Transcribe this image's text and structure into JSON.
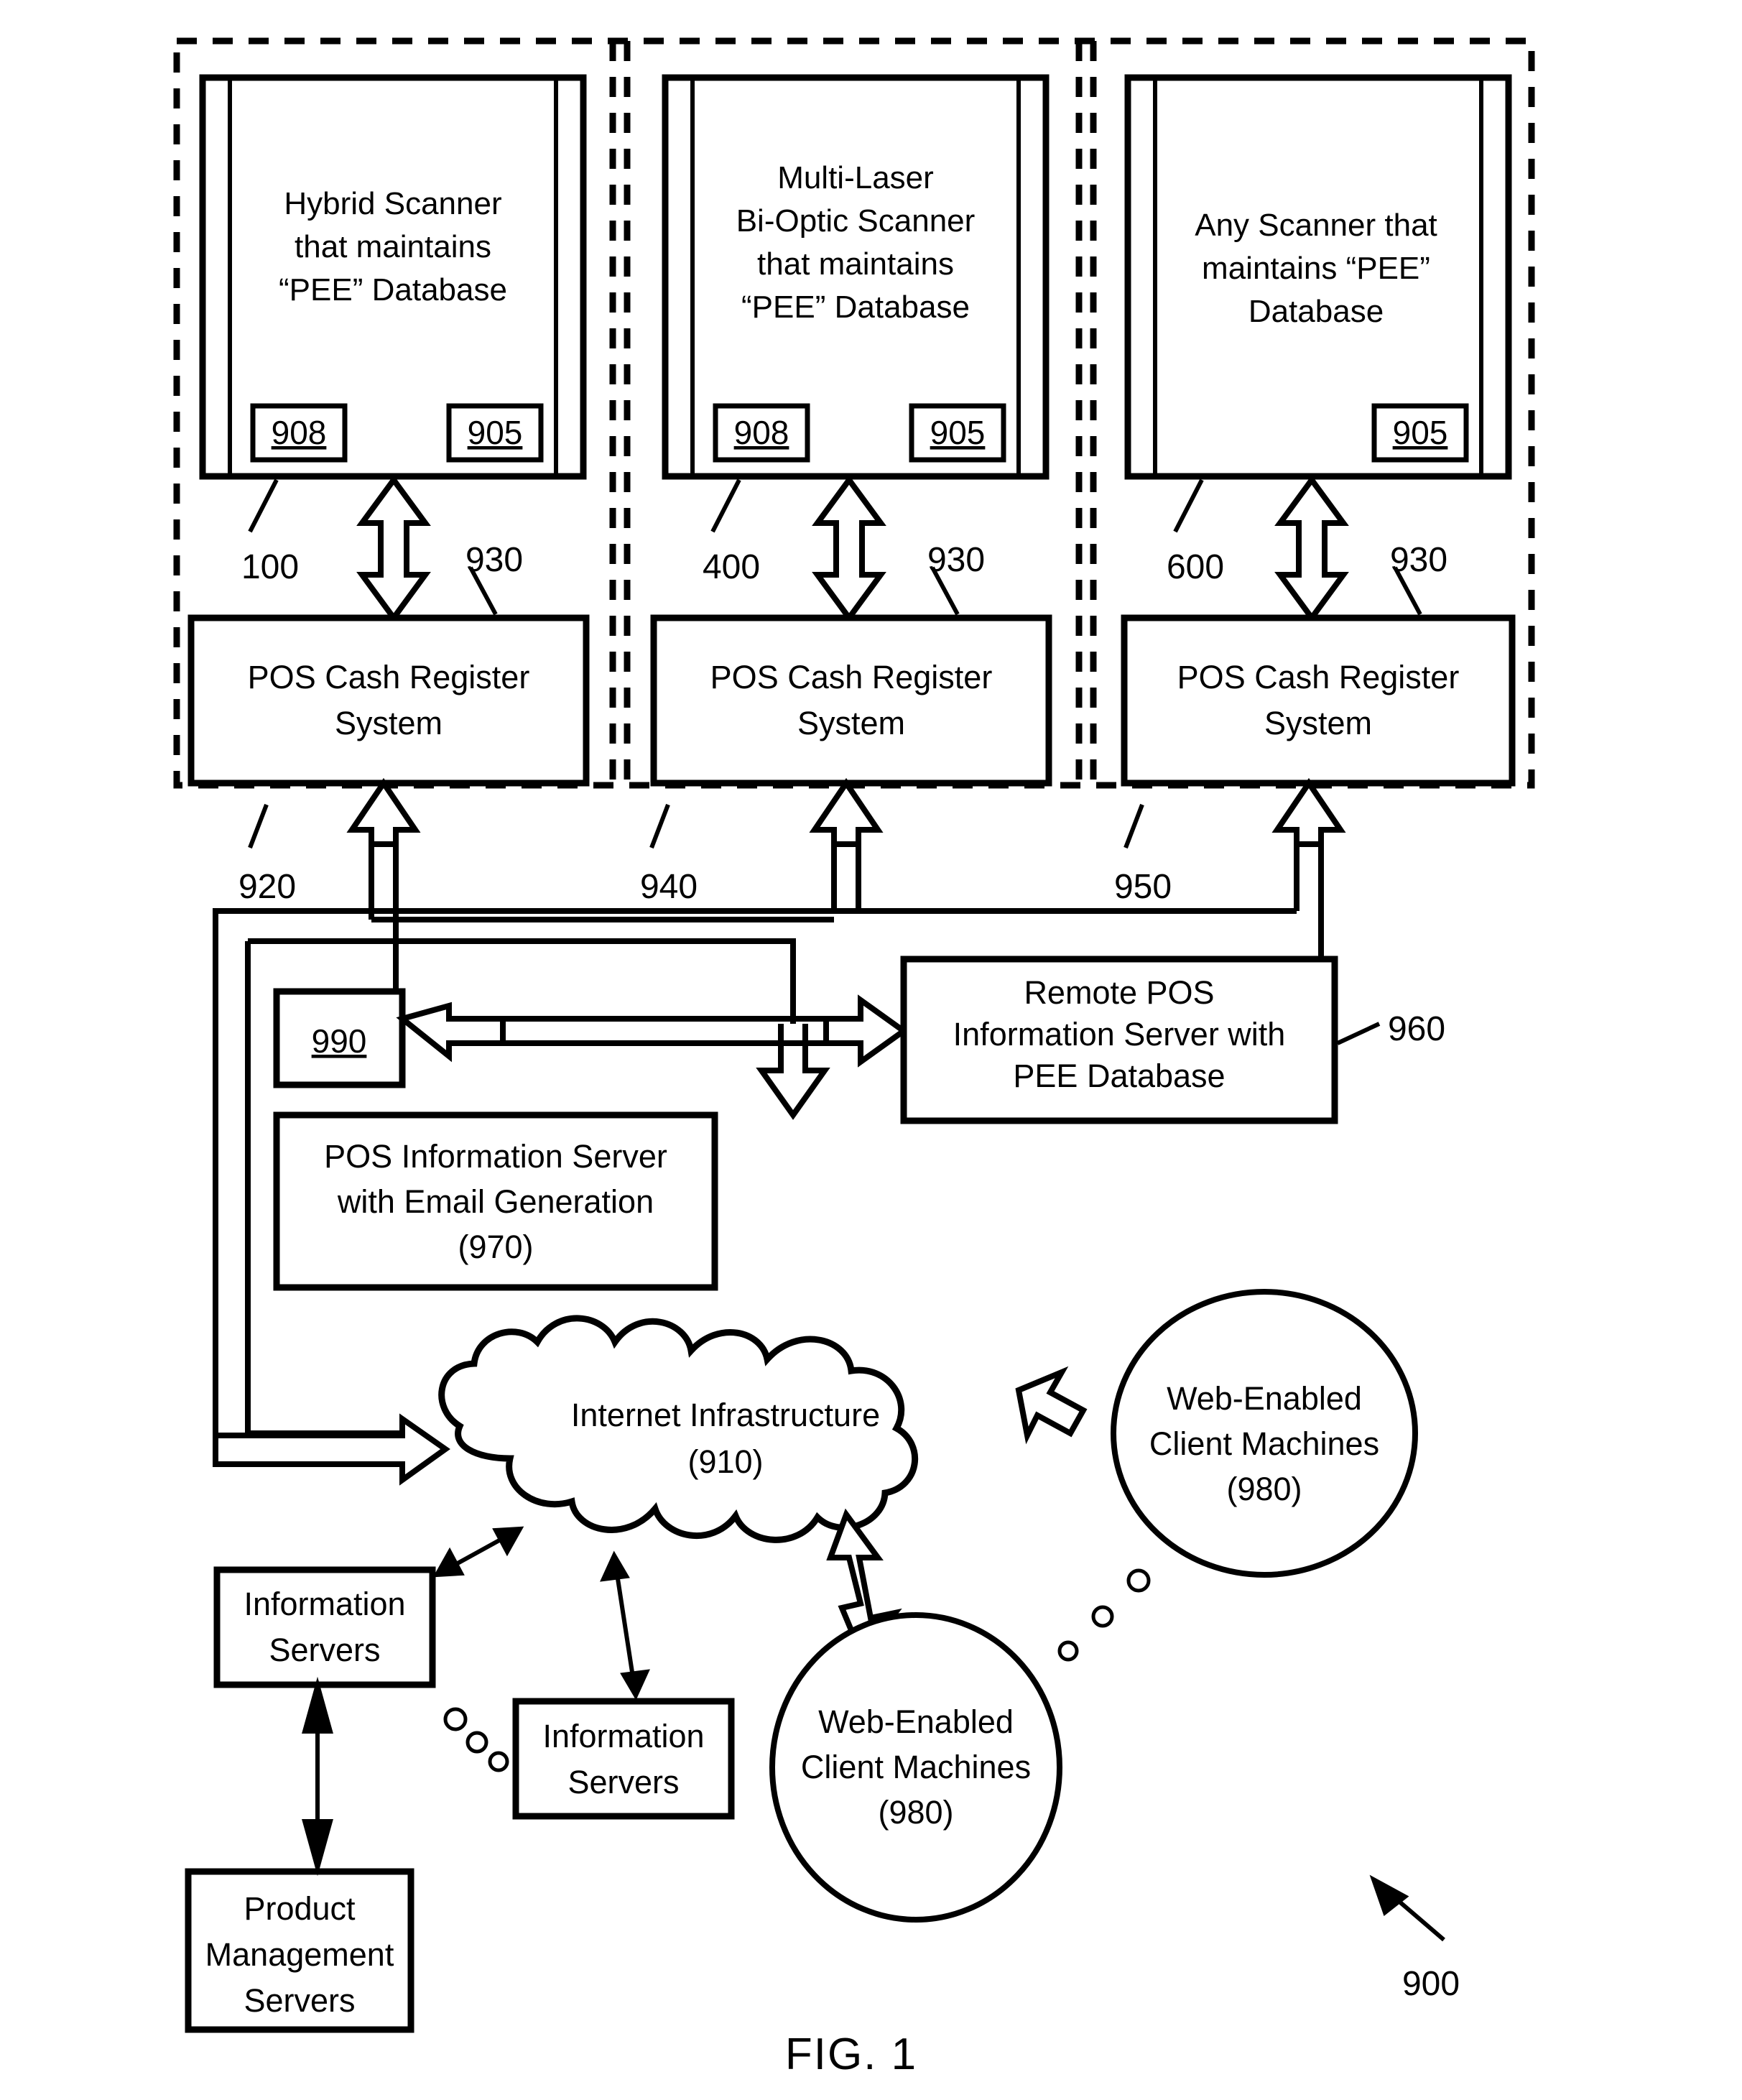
{
  "figure": {
    "caption": "FIG. 1",
    "system_ref": "900"
  },
  "panels": [
    {
      "scanner": {
        "lines": [
          "Hybrid Scanner",
          "that maintains",
          "“PEE” Database"
        ],
        "ref_boxes": [
          "908",
          "905"
        ],
        "leader_ref": "100"
      },
      "link_ref": "930",
      "pos": {
        "lines": [
          "POS Cash Register",
          "System"
        ]
      },
      "bus_ref": "920"
    },
    {
      "scanner": {
        "lines": [
          "Multi-Laser",
          "Bi-Optic Scanner",
          "that maintains",
          "“PEE” Database"
        ],
        "ref_boxes": [
          "908",
          "905"
        ],
        "leader_ref": "400"
      },
      "link_ref": "930",
      "pos": {
        "lines": [
          "POS Cash Register",
          "System"
        ]
      },
      "bus_ref": "940"
    },
    {
      "scanner": {
        "lines": [
          "Any Scanner that",
          "maintains “PEE”",
          "Database"
        ],
        "ref_boxes": [
          "905"
        ],
        "leader_ref": "600"
      },
      "link_ref": "930",
      "pos": {
        "lines": [
          "POS Cash Register",
          "System"
        ]
      },
      "bus_ref": "950"
    }
  ],
  "nodes": {
    "hub_ref": "990",
    "remote_server": {
      "lines": [
        "Remote POS",
        "Information  Server with",
        "PEE Database"
      ],
      "leader_ref": "960"
    },
    "pos_info_server": {
      "lines": [
        "POS Information Server",
        "with Email Generation",
        "(970)"
      ]
    },
    "internet": {
      "lines": [
        "Internet Infrastructure",
        "(910)"
      ]
    },
    "client_top": {
      "lines": [
        "Web-Enabled",
        "Client Machines",
        "(980)"
      ]
    },
    "client_bottom": {
      "lines": [
        "Web-Enabled",
        "Client Machines",
        "(980)"
      ]
    },
    "info_server_1": {
      "lines": [
        "Information",
        "Servers"
      ]
    },
    "info_server_2": {
      "lines": [
        "Information",
        "Servers"
      ]
    },
    "product_mgmt": {
      "lines": [
        "Product",
        "Management",
        "Servers"
      ]
    }
  }
}
